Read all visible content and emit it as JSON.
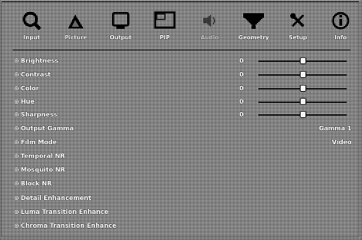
{
  "toolbar": [
    {
      "label": "Input",
      "icon": "magnifier-icon"
    },
    {
      "label": "Picture",
      "icon": "triangle-icon"
    },
    {
      "label": "Output",
      "icon": "monitor-icon"
    },
    {
      "label": "PIP",
      "icon": "pip-icon"
    },
    {
      "label": "Audio",
      "icon": "speaker-icon"
    },
    {
      "label": "Geometry",
      "icon": "funnel-icon"
    },
    {
      "label": "Setup",
      "icon": "tools-icon"
    },
    {
      "label": "Info",
      "icon": "info-icon"
    }
  ],
  "selected_tab": "Picture",
  "settings": [
    {
      "label": "Brightness",
      "value": "0",
      "slider_fraction": 0.5
    },
    {
      "label": "Contrast",
      "value": "0",
      "slider_fraction": 0.5
    },
    {
      "label": "Color",
      "value": "0",
      "slider_fraction": 0.5
    },
    {
      "label": "Hue",
      "value": "0",
      "slider_fraction": 0.5
    },
    {
      "label": "Sharpness",
      "value": "0",
      "slider_fraction": 0.5
    },
    {
      "label": "Output Gamma",
      "right_value": "Gamma 1"
    },
    {
      "label": "Film Mode",
      "right_value": "Video"
    },
    {
      "label": "Temporal NR"
    },
    {
      "label": "Mosquito NR"
    },
    {
      "label": "Block NR"
    },
    {
      "label": "Detail Enhancement"
    },
    {
      "label": "Luma Transition Enhance"
    },
    {
      "label": "Chroma Transition Enhance"
    }
  ],
  "expander_glyph": "⊕"
}
